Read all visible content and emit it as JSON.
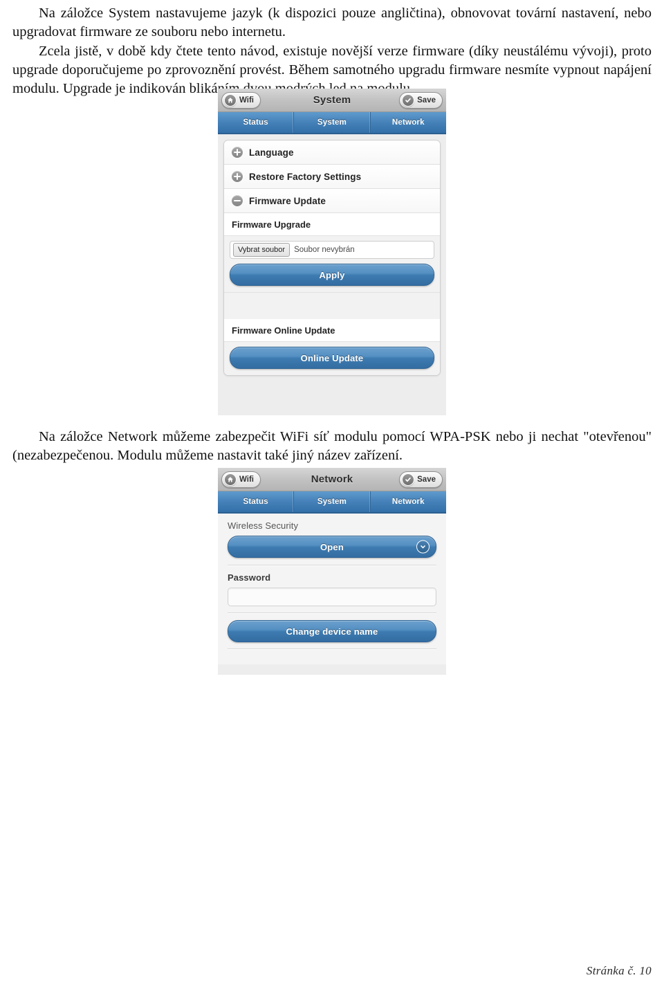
{
  "document": {
    "paragraphs_top": [
      "Na záložce System nastavujeme jazyk (k dispozici pouze angličtina), obnovovat tovární nastavení, nebo upgradovat firmware ze souboru nebo internetu.",
      "Zcela jistě, v době kdy čtete tento návod, existuje novější verze firmware (díky neustálému vývoji), proto upgrade doporučujeme po zprovoznění provést. Během samotného upgradu firmware nesmíte vypnout napájení modulu. Upgrade je indikován blikáním dvou modrých led na modulu."
    ],
    "paragraphs_middle": [
      "Na záložce Network můžeme zabezpečit WiFi síť modulu pomocí WPA-PSK nebo ji nechat \"otevřenou\" (nezabezpečenou. Modulu můžeme nastavit také jiný název zařízení."
    ],
    "footer": "Stránka č. 10"
  },
  "colors": {
    "tab_blue": "#4682b9",
    "button_blue": "#3e7bb0",
    "chrome_gray": "#c2c2c2",
    "panel_gray": "#ededed"
  },
  "screenshot_system": {
    "topbar": {
      "left_button_label": "Wifi",
      "left_button_icon": "home-icon",
      "title": "System",
      "right_button_label": "Save",
      "right_button_icon": "check-circle-icon"
    },
    "tabs": [
      {
        "label": "Status"
      },
      {
        "label": "System"
      },
      {
        "label": "Network"
      }
    ],
    "accordion": [
      {
        "label": "Language",
        "icon": "plus-circle-icon",
        "expanded": false
      },
      {
        "label": "Restore Factory Settings",
        "icon": "plus-circle-icon",
        "expanded": false
      },
      {
        "label": "Firmware Update",
        "icon": "minus-circle-icon",
        "expanded": true
      }
    ],
    "firmware_upgrade": {
      "heading": "Firmware Upgrade",
      "file_button_label": "Vybrat soubor",
      "file_status_text": "Soubor nevybrán",
      "apply_label": "Apply"
    },
    "firmware_online_update": {
      "heading": "Firmware Online Update",
      "button_label": "Online Update"
    }
  },
  "screenshot_network": {
    "topbar": {
      "left_button_label": "Wifi",
      "left_button_icon": "home-icon",
      "title": "Network",
      "right_button_label": "Save",
      "right_button_icon": "check-circle-icon"
    },
    "tabs": [
      {
        "label": "Status"
      },
      {
        "label": "System"
      },
      {
        "label": "Network"
      }
    ],
    "wireless_security": {
      "label": "Wireless Security",
      "selected_value": "Open",
      "caret_icon": "chevron-down-icon"
    },
    "password": {
      "label": "Password",
      "value": ""
    },
    "change_device_name_label": "Change device name"
  }
}
